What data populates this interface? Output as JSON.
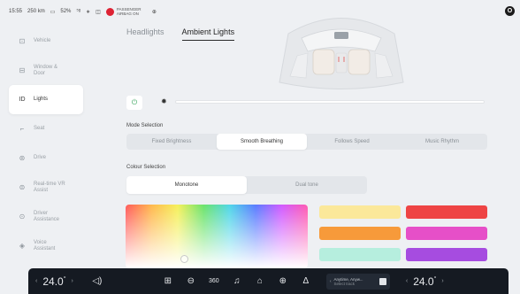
{
  "status": {
    "time": "15:55",
    "range": "250 km",
    "battery": "52%",
    "passenger_airbag": "PASSENGER AIRBAG ON"
  },
  "sidebar": {
    "items": [
      {
        "label": "Vehicle",
        "icon": "car-icon"
      },
      {
        "label": "Window &\nDoor",
        "icon": "window-icon"
      },
      {
        "label": "Lights",
        "icon": "lights-icon",
        "active": true
      },
      {
        "label": "Seat",
        "icon": "seat-icon"
      },
      {
        "label": "Drive",
        "icon": "steering-wheel-icon"
      },
      {
        "label": "Real-time VR\nAssist",
        "icon": "vr-assist-icon"
      },
      {
        "label": "Driver\nAssistance",
        "icon": "driver-assistance-icon"
      },
      {
        "label": "Voice\nAssistant",
        "icon": "voice-assistant-icon"
      }
    ]
  },
  "tabs": [
    {
      "label": "Headlights",
      "active": false
    },
    {
      "label": "Ambient Lights",
      "active": true
    }
  ],
  "brightness": {
    "level": 0.0
  },
  "mode_selection": {
    "label": "Mode Selection",
    "options": [
      "Fixed Brightness",
      "Smooth Breathing",
      "Follows Speed",
      "Music Rhythm"
    ],
    "selected": "Smooth Breathing"
  },
  "colour_selection": {
    "label": "Colour Selection",
    "options": [
      "Monotone",
      "Dual tone"
    ],
    "selected": "Monotone"
  },
  "swatches": [
    "#fbe89a",
    "#ee4444",
    "#f79a3a",
    "#e64fc8",
    "#b6eede",
    "#a64ce0"
  ],
  "dock": {
    "left_temp": "24.0",
    "right_temp": "24.0",
    "deg": "°",
    "media_title": "Anytime, Anyw...",
    "media_subtitle": "Select track",
    "icons": [
      "volume-icon",
      "apps-icon",
      "car-status-icon",
      "camera-360-icon",
      "music-icon",
      "home-icon",
      "climate-icon",
      "navigation-icon"
    ]
  }
}
